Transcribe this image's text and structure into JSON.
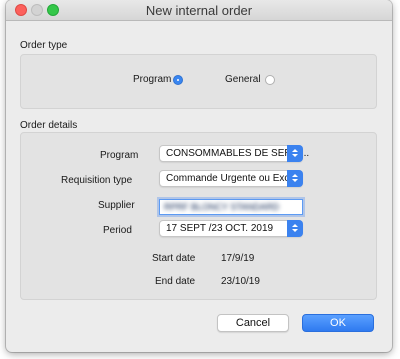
{
  "window": {
    "title": "New internal order"
  },
  "order_type": {
    "section_label": "Order type",
    "options": [
      {
        "label": "Program",
        "selected": true
      },
      {
        "label": "General",
        "selected": false
      }
    ]
  },
  "order_details": {
    "section_label": "Order details",
    "program": {
      "label": "Program",
      "value": "CONSOMMABLES DE SERVI..."
    },
    "requisition_type": {
      "label": "Requisition type",
      "value": "Commande Urgente ou Exc..."
    },
    "supplier": {
      "label": "Supplier",
      "value": "RPRF BLONCY STANDARD"
    },
    "period": {
      "label": "Period",
      "value": "17 SEPT /23 OCT. 2019"
    },
    "start_date": {
      "label": "Start date",
      "value": "17/9/19"
    },
    "end_date": {
      "label": "End date",
      "value": "23/10/19"
    }
  },
  "buttons": {
    "cancel": "Cancel",
    "ok": "OK"
  },
  "colors": {
    "accent": "#3b82ef",
    "close": "#fc605c",
    "zoom": "#34c749"
  }
}
